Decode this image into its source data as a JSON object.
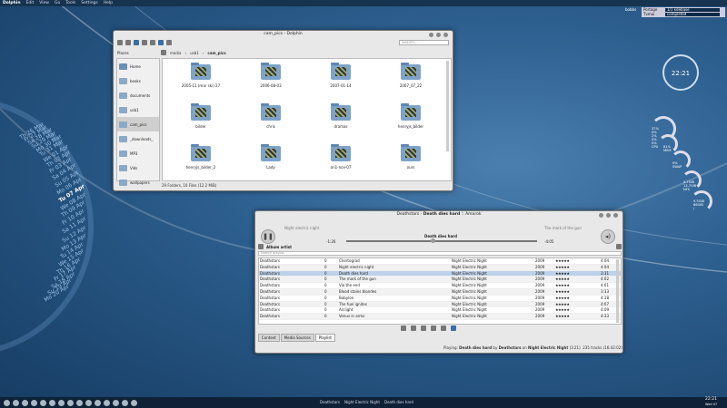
{
  "topbar": {
    "app": "Dolphin",
    "menus": [
      "Edit",
      "View",
      "Go",
      "Tools",
      "Settings",
      "Help"
    ]
  },
  "status": {
    "lines": [
      "Portage",
      "Tvmai"
    ],
    "values": [
      "1/1 kdebase",
      "completed"
    ],
    "user": "bobbs"
  },
  "dolphin": {
    "title": "cam_pics - Dolphin",
    "places_label": "Places",
    "search_placeholder": "Search...",
    "path": [
      "media",
      "usb1",
      "cam_pics"
    ],
    "places": [
      "Home",
      "books",
      "documents",
      "usb1",
      "cam_pics",
      "_downloads_",
      "MP3",
      "Vids",
      "wallpapers"
    ],
    "files": [
      "2005-11 (mar ski) 27",
      "2006-08-03",
      "2007-01-14",
      "2007_07_22",
      "bilder",
      "chris",
      "dramas",
      "henryjs_bilder",
      "henryjs_bilder_2",
      "Lady",
      "on1-nov-07",
      "ours"
    ],
    "status": "29 Folders, 10 Files (12.2 MiB)"
  },
  "amarok": {
    "title_prefix": "Deathstars - ",
    "title_track": "Death dies hard",
    "title_suffix": " :: Amarok",
    "prev_track": "Night electric night",
    "next_track": "The mark of the gun",
    "current": "Death dies hard",
    "elapsed": "-1:26",
    "remaining": "-4:05",
    "progress": 0.45,
    "crumb": "Album artist",
    "filter_placeholder": "Search playlist",
    "playlist": [
      {
        "artist": "Deathstars",
        "n": "0",
        "title": "Chertograd",
        "album": "Night Electric Night",
        "year": "2009",
        "len": "4:04"
      },
      {
        "artist": "Deathstars",
        "n": "0",
        "title": "Night electric night",
        "album": "Night Electric Night",
        "year": "2009",
        "len": "4:04"
      },
      {
        "artist": "Deathstars",
        "n": "0",
        "title": "Death dies hard",
        "album": "Night Electric Night",
        "year": "2009",
        "len": "3:31"
      },
      {
        "artist": "Deathstars",
        "n": "0",
        "title": "The mark of the gun",
        "album": "Night Electric Night",
        "year": "2009",
        "len": "4:02"
      },
      {
        "artist": "Deathstars",
        "n": "0",
        "title": "Via the end",
        "album": "Night Electric Night",
        "year": "2009",
        "len": "4:01"
      },
      {
        "artist": "Deathstars",
        "n": "0",
        "title": "Blood stains blondes",
        "album": "Night Electric Night",
        "year": "2009",
        "len": "3:33"
      },
      {
        "artist": "Deathstars",
        "n": "0",
        "title": "Babylon",
        "album": "Night Electric Night",
        "year": "2009",
        "len": "4:18"
      },
      {
        "artist": "Deathstars",
        "n": "0",
        "title": "The fuel ignites",
        "album": "Night Electric Night",
        "year": "2009",
        "len": "4:07"
      },
      {
        "artist": "Deathstars",
        "n": "0",
        "title": "Arclight",
        "album": "Night Electric Night",
        "year": "2009",
        "len": "4:09"
      },
      {
        "artist": "Deathstars",
        "n": "0",
        "title": "Venus in arms",
        "album": "Night Electric Night",
        "year": "2009",
        "len": "4:33"
      }
    ],
    "rating": "★★★★★",
    "tabs": [
      "Context",
      "Media Sources",
      "Playlist"
    ],
    "status_prefix": "Playing: ",
    "status_track": "Death dies hard",
    "status_by": " by ",
    "status_artist": "Deathstars",
    "status_on": " on ",
    "status_album": "Night Electric Night",
    "status_pos": "(3:21)",
    "status_count": "235 tracks (16:42:02)"
  },
  "calendar": [
    "26 Mar",
    "27 Mar",
    "28 Mar",
    "29 Mar",
    "30 Mar",
    "31 Mar",
    "01 Apr",
    "02 Apr",
    "03 Apr",
    "04 Apr",
    "05 Apr",
    "06 Apr",
    "07 Apr",
    "08 Apr",
    "09 Apr",
    "10 Apr",
    "11 Apr",
    "12 Apr",
    "13 Apr",
    "14 Apr",
    "15 Apr",
    "16 Apr",
    "17 Apr",
    "18 Apr",
    "19 Apr",
    "20 Apr"
  ],
  "calendar_days": [
    "Th",
    "Fr",
    "Sa",
    "Su",
    "Mo",
    "Tu",
    "We",
    "Th",
    "Fr",
    "Sa",
    "Su",
    "Mo",
    "Tu",
    "We",
    "Th",
    "Fr",
    "Sa",
    "Su",
    "Mo",
    "Tu",
    "We",
    "Th",
    "Fr",
    "Sa",
    "Su",
    "Mo"
  ],
  "clock": "22:21",
  "gauges": {
    "g1": [
      "37%",
      "0%",
      "2%",
      "0%",
      "0%",
      "CPU"
    ],
    "g2": [
      "81%",
      "MEM"
    ],
    "g3": [
      "0%",
      "SWAP"
    ],
    "g4": [
      "4.7GiB",
      "13.7GiB",
      "NFS"
    ],
    "g5": [
      "9.5GiB",
      "86GiB",
      "/ "
    ]
  },
  "taskbar": {
    "now_playing": [
      "Deathstars",
      "Night Electric Night",
      "Death dies hard"
    ],
    "clock": "22:21",
    "date": "Wed 07"
  },
  "colors": {
    "accent": "#3a6ea5",
    "desktop": "#2d5f8f"
  }
}
